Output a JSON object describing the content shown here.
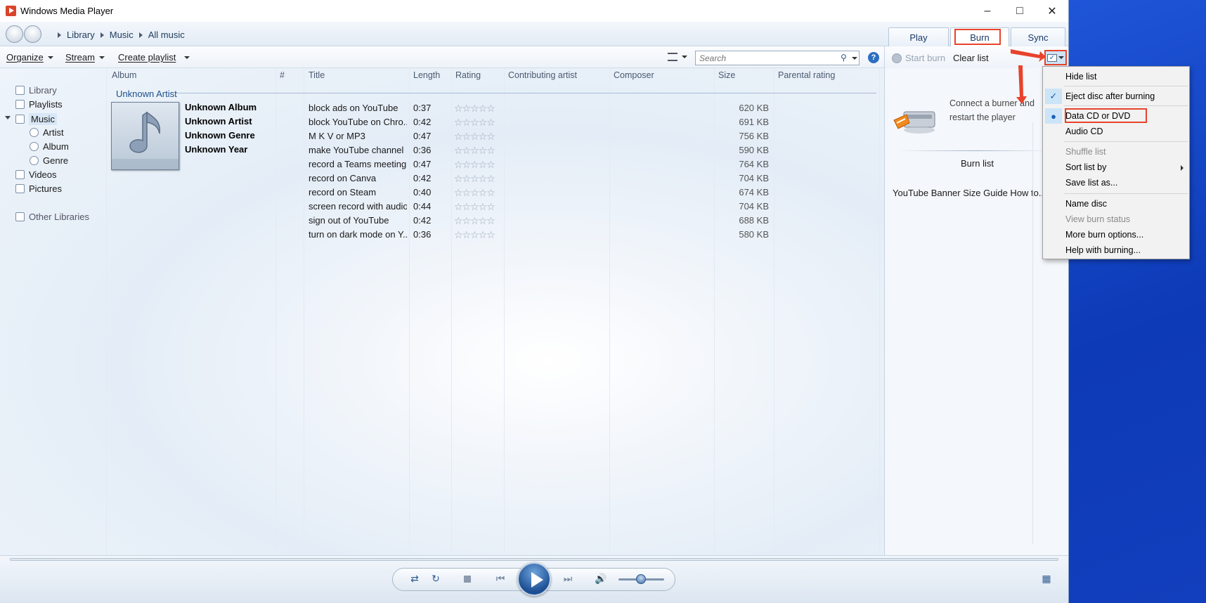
{
  "window": {
    "title": "Windows Media Player"
  },
  "breadcrumb": [
    "Library",
    "Music",
    "All music"
  ],
  "tabs": {
    "play": "Play",
    "burn": "Burn",
    "sync": "Sync"
  },
  "toolbar": {
    "organize": "Organize",
    "stream": "Stream",
    "create_playlist": "Create playlist"
  },
  "search": {
    "placeholder": "Search"
  },
  "nav": {
    "library": "Library",
    "playlists": "Playlists",
    "music": "Music",
    "artist": "Artist",
    "album": "Album",
    "genre": "Genre",
    "videos": "Videos",
    "pictures": "Pictures",
    "other_libraries": "Other Libraries"
  },
  "columns": {
    "album": "Album",
    "number": "#",
    "title": "Title",
    "length": "Length",
    "rating": "Rating",
    "contributing_artist": "Contributing artist",
    "composer": "Composer",
    "size": "Size",
    "parental_rating": "Parental rating"
  },
  "group": {
    "artist": "Unknown Artist",
    "album": "Unknown Album",
    "album_artist": "Unknown Artist",
    "genre": "Unknown Genre",
    "year": "Unknown Year"
  },
  "tracks": [
    {
      "title": "block ads on YouTube",
      "length": "0:37",
      "size": "620 KB"
    },
    {
      "title": "block YouTube on Chro...",
      "length": "0:42",
      "size": "691 KB"
    },
    {
      "title": "M K V or MP3",
      "length": "0:47",
      "size": "756 KB"
    },
    {
      "title": "make YouTube channel ...",
      "length": "0:36",
      "size": "590 KB"
    },
    {
      "title": "record a Teams meeting",
      "length": "0:47",
      "size": "764 KB"
    },
    {
      "title": "record on Canva",
      "length": "0:42",
      "size": "704 KB"
    },
    {
      "title": "record on Steam",
      "length": "0:40",
      "size": "674 KB"
    },
    {
      "title": "screen record with audio",
      "length": "0:44",
      "size": "704 KB"
    },
    {
      "title": "sign out of YouTube",
      "length": "0:42",
      "size": "688 KB"
    },
    {
      "title": "turn on dark mode on Y...",
      "length": "0:36",
      "size": "580 KB"
    }
  ],
  "burn_pane": {
    "start_burn": "Start burn",
    "clear_list": "Clear list",
    "message": "Connect a burner and restart the player",
    "burn_list_label": "Burn list",
    "items": "YouTube Banner Size Guide  How to..."
  },
  "menu": {
    "hide_list": "Hide list",
    "eject": "Eject disc after burning",
    "data_cd": "Data CD or DVD",
    "audio_cd": "Audio CD",
    "shuffle": "Shuffle list",
    "sort": "Sort list by",
    "save": "Save list as...",
    "name_disc": "Name disc",
    "view_status": "View burn status",
    "more_options": "More burn options...",
    "help": "Help with burning..."
  },
  "colors": {
    "highlight_red": "#e8432c",
    "accent_blue": "#1a5fb4",
    "desktop_blue": "#1746c8"
  }
}
